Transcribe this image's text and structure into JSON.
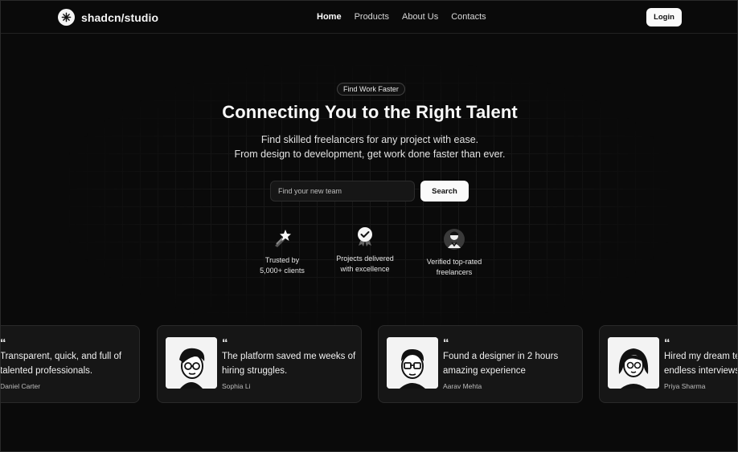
{
  "brand": {
    "name": "shadcn/studio",
    "logo_icon": "asterisk-logo-icon"
  },
  "nav": {
    "items": [
      {
        "label": "Home",
        "active": true
      },
      {
        "label": "Products",
        "active": false
      },
      {
        "label": "About Us",
        "active": false
      },
      {
        "label": "Contacts",
        "active": false
      }
    ],
    "login_label": "Login"
  },
  "hero": {
    "badge": "Find Work Faster",
    "title": "Connecting You to the Right Talent",
    "subtitle_line1": "Find skilled freelancers for any project with ease.",
    "subtitle_line2": "From design to development, get work done faster than ever."
  },
  "search": {
    "placeholder": "Find your new team",
    "button_label": "Search"
  },
  "stats": [
    {
      "icon": "shooting-star-icon",
      "line1": "Trusted by",
      "line2": "5,000+ clients"
    },
    {
      "icon": "verified-badge-icon",
      "line1": "Projects delivered",
      "line2": "with excellence"
    },
    {
      "icon": "top-rated-freelancer-icon",
      "line1": "Verified top-rated",
      "line2": "freelancers"
    }
  ],
  "testimonials": [
    {
      "quote": "Transparent, quick, and full of talented professionals.",
      "author": "Daniel Carter"
    },
    {
      "quote": "The platform saved me weeks of hiring struggles.",
      "author": "Sophia Li"
    },
    {
      "quote": "Found a designer in 2 hours amazing experience",
      "author": "Aarav Mehta"
    },
    {
      "quote": "Hired my dream team without endless interviews",
      "author": "Priya Sharma"
    }
  ],
  "colors": {
    "background": "#0a0a0a",
    "card": "#161616",
    "accent": "#fafafa"
  }
}
